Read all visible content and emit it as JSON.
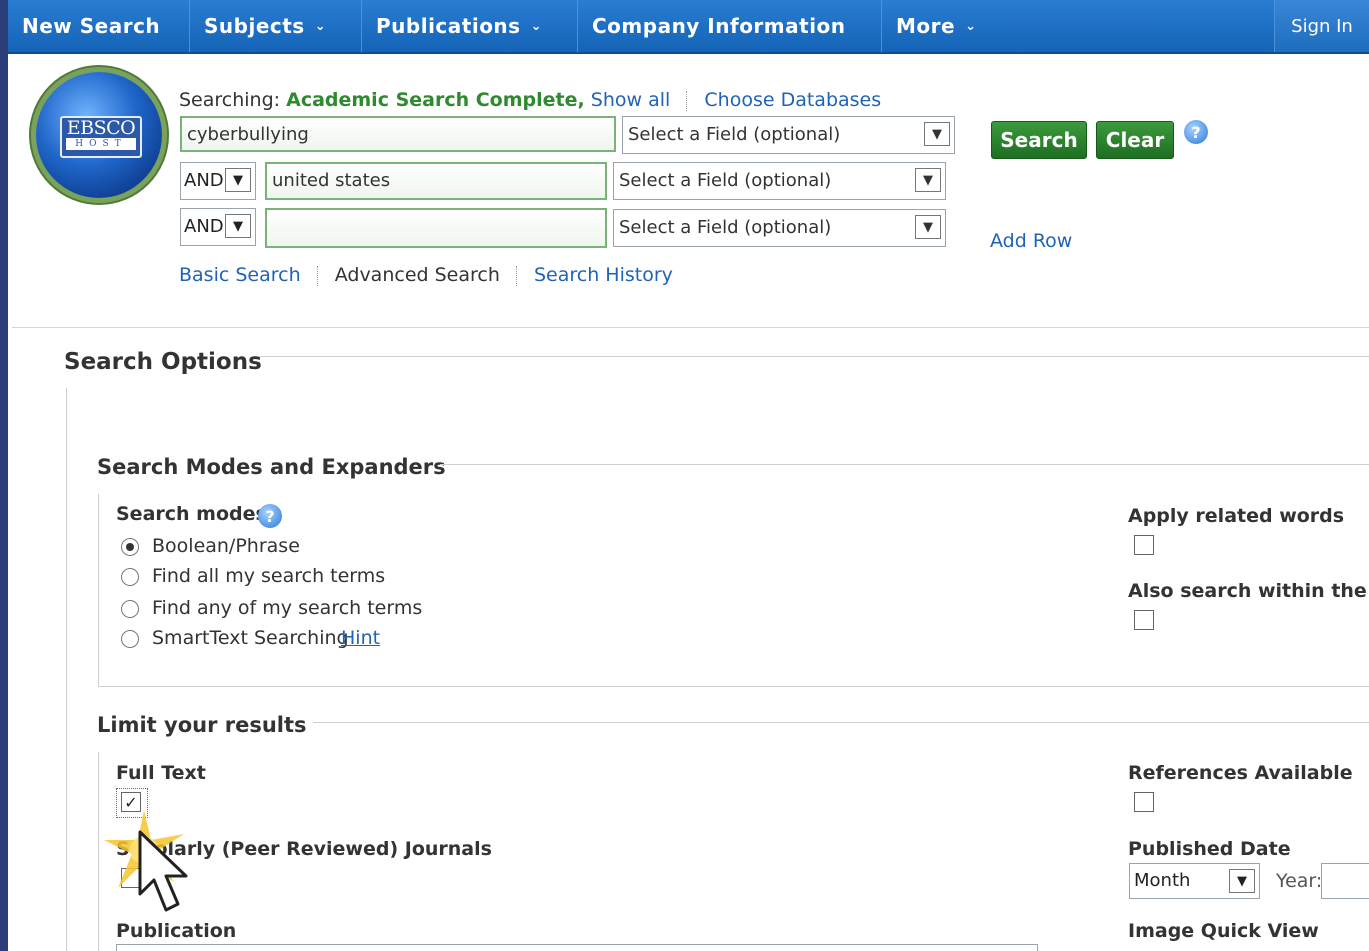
{
  "nav": {
    "items": [
      {
        "label": "New Search",
        "chev": ""
      },
      {
        "label": "Subjects",
        "chev": "⌄"
      },
      {
        "label": "Publications",
        "chev": "⌄"
      },
      {
        "label": "Company Information",
        "chev": ""
      },
      {
        "label": "More",
        "chev": "⌄"
      }
    ],
    "signin": "Sign In"
  },
  "logo": {
    "brand": "EBSCO",
    "sub": "HOST"
  },
  "search": {
    "searching_prefix": "Searching:",
    "database": "Academic Search Complete,",
    "show_all": "Show all",
    "choose_databases": "Choose Databases",
    "rows": [
      {
        "operator": "",
        "term": "cyberbullying",
        "field": "Select a Field (optional)"
      },
      {
        "operator": "AND",
        "term": "united states",
        "field": "Select a Field (optional)"
      },
      {
        "operator": "AND",
        "term": "",
        "field": "Select a Field (optional)"
      }
    ],
    "search_button": "Search",
    "clear_button": "Clear",
    "help_symbol": "?",
    "add_row": "Add Row",
    "basic_search": "Basic Search",
    "advanced_search": "Advanced Search",
    "search_history": "Search History"
  },
  "options": {
    "title": "Search Options",
    "modes_section": "Search Modes and Expanders",
    "search_modes_label": "Search modes",
    "modes": [
      {
        "label": "Boolean/Phrase",
        "selected": true
      },
      {
        "label": "Find all my search terms",
        "selected": false
      },
      {
        "label": "Find any of my search terms",
        "selected": false
      },
      {
        "label": "SmartText Searching",
        "selected": false
      }
    ],
    "hint": "Hint",
    "apply_related": "Apply related words",
    "also_search": "Also search within the ful",
    "limit_section": "Limit your results",
    "full_text": "Full Text",
    "full_text_checked": true,
    "check_mark": "✓",
    "scholarly": "Scholarly (Peer Reviewed) Journals",
    "publication": "Publication",
    "references_available": "References Available",
    "published_date": "Published Date",
    "month": "Month",
    "year": "Year:",
    "image_quick_view": "Image Quick View"
  },
  "colors": {
    "nav": "#1463b7",
    "button": "#2a842c",
    "link": "#1f63b7",
    "database": "#2f8a2f"
  }
}
